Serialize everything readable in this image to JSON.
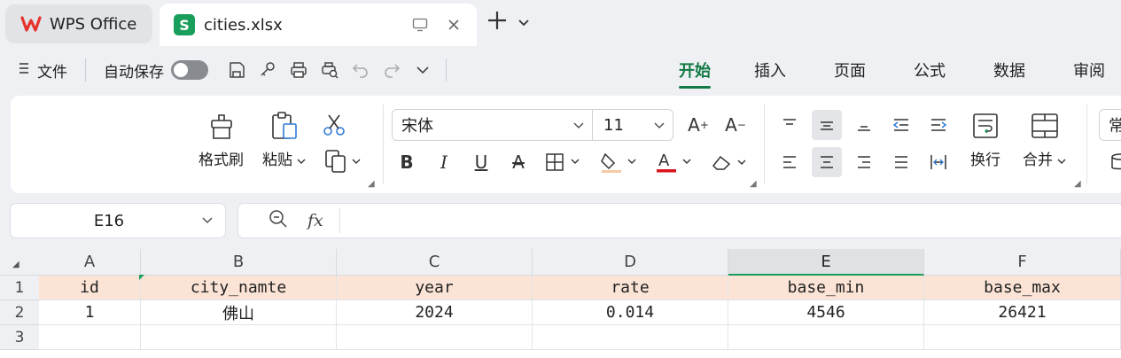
{
  "tabs": {
    "app": {
      "label": "WPS Office",
      "icon": "wps-logo-icon"
    },
    "file": {
      "label": "cities.xlsx",
      "icon": "spreadsheet-s-icon",
      "badge": "S"
    }
  },
  "menu": {
    "file_label": "文件",
    "autosave_label": "自动保存",
    "ribbon_tabs": [
      "开始",
      "插入",
      "页面",
      "公式",
      "数据",
      "审阅"
    ]
  },
  "ribbon": {
    "format_painter": "格式刷",
    "paste": "粘贴",
    "font_name": "宋体",
    "font_size": "11",
    "wrap": "换行",
    "merge": "合并",
    "cut_off": "常"
  },
  "formula_bar": {
    "cell_ref": "E16",
    "fx_label": "fx",
    "content": ""
  },
  "sheet": {
    "columns": [
      "A",
      "B",
      "C",
      "D",
      "E",
      "F"
    ],
    "selected_column": "E",
    "row_numbers": [
      "1",
      "2",
      "3"
    ],
    "rows": [
      [
        "id",
        "city_namte",
        "year",
        "rate",
        "base_min",
        "base_max"
      ],
      [
        "1",
        "佛山",
        "2024",
        "0.014",
        "4546",
        "26421"
      ],
      [
        "",
        "",
        "",
        "",
        "",
        ""
      ]
    ]
  },
  "colors": {
    "accent": "#137a45",
    "header_fill": "#fbe4d6",
    "wps_red": "#e5332a"
  }
}
